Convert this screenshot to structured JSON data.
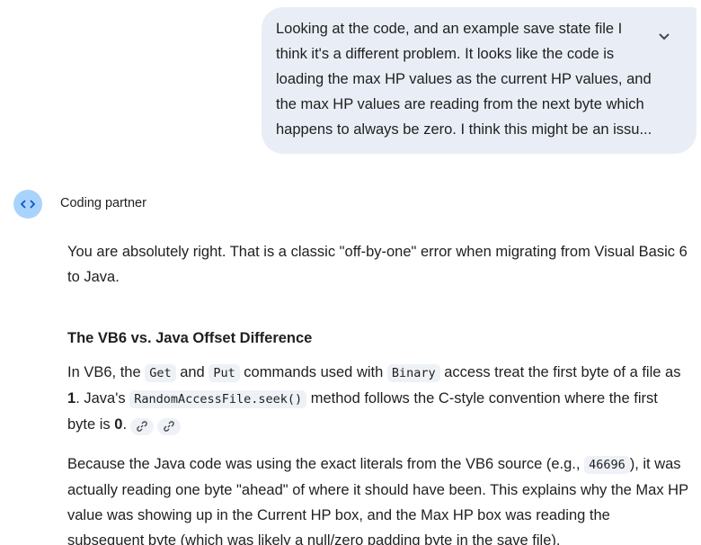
{
  "user_message": {
    "text": "Looking at the code, and an example save state file I think it's a different problem. It looks like the code is loading the max HP values as the current HP values, and the max HP values are reading from the next byte which happens to always be zero. I think this might be an issu..."
  },
  "assistant": {
    "name": "Coding partner"
  },
  "response": {
    "intro": "You are absolutely right. That is a classic \"off-by-one\" error when migrating from Visual Basic 6 to Java.",
    "heading": "The VB6 vs. Java Offset Difference",
    "p2": {
      "t1": "In VB6, the ",
      "code_get": "Get",
      "t2": " and ",
      "code_put": "Put",
      "t3": " commands used with ",
      "code_binary": "Binary",
      "t4": " access treat the first byte of a file as ",
      "bold_one": "1",
      "t5": ". Java's ",
      "code_seek": "RandomAccessFile.seek()",
      "t6": " method follows the C-style convention where the first byte is ",
      "bold_zero": "0",
      "t7": "."
    },
    "p3": {
      "t1": "Because the Java code was using the exact literals from the VB6 source (e.g., ",
      "code_offset": "46696",
      "t2": "), it was actually reading one byte \"ahead\" of where it should have been. This explains why the Max HP value was showing up in the Current HP box, and the Max HP box was reading the subsequent byte (which was likely a null/zero padding byte in the save file)."
    }
  },
  "icons": {
    "expand": "chevron-down-icon",
    "avatar": "code-brackets-icon",
    "citation": "link-icon"
  },
  "colors": {
    "user_bubble": "#e9eef6",
    "avatar_bg": "#a8d3fc",
    "code_bg": "#eef1f6",
    "text": "#1f1f1f"
  }
}
